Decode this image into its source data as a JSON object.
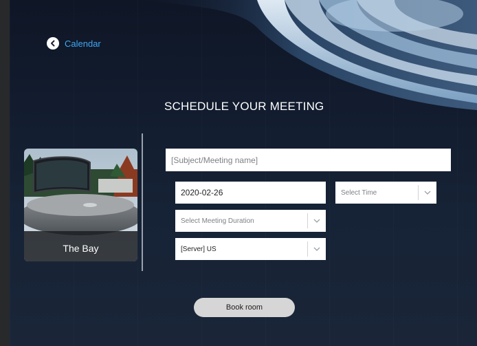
{
  "nav": {
    "back_label": "Calendar"
  },
  "page": {
    "title": "SCHEDULE YOUR MEETING"
  },
  "room": {
    "name": "The Bay"
  },
  "form": {
    "subject": {
      "placeholder": "[Subject/Meeting name]",
      "value": ""
    },
    "date": {
      "value": "2020-02-26"
    },
    "time": {
      "selected": "Select Time"
    },
    "duration": {
      "selected": "Select Meeting Duration"
    },
    "server": {
      "selected": "[Server] US"
    }
  },
  "actions": {
    "book_label": "Book room"
  },
  "colors": {
    "accent": "#3fa8f4",
    "background": "#131c2d",
    "field_bg": "#ffffff",
    "button_bg": "#d6d6d6"
  },
  "icons": {
    "back": "chevron-left-circle-icon",
    "dropdown": "chevron-down-icon"
  }
}
